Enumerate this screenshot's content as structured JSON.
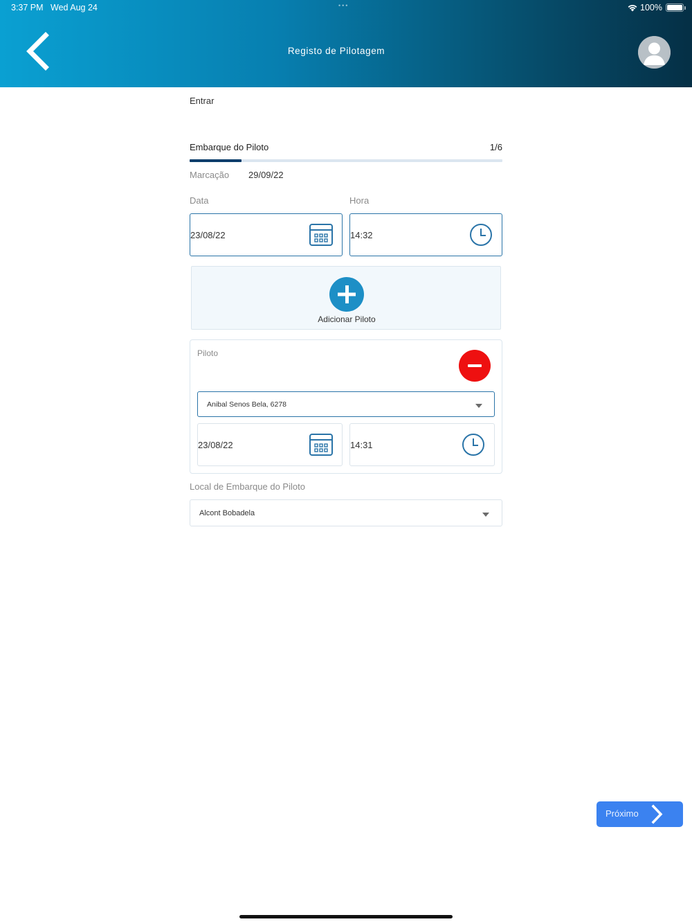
{
  "status_bar": {
    "time": "3:37 PM",
    "date": "Wed Aug 24",
    "dots": "•••",
    "battery": "100%"
  },
  "header": {
    "title": "Registo de Pilotagem",
    "back_icon": "chevron-left-icon",
    "avatar_icon": "user-avatar-icon"
  },
  "section": {
    "label": "Entrar"
  },
  "step": {
    "title": "Embarque do Piloto",
    "counter": "1/6",
    "progress": 0.1667
  },
  "marcacao": {
    "label": "Marcação",
    "value": "29/09/22"
  },
  "date_time": {
    "data_label": "Data",
    "data_value": "23/08/22",
    "hora_label": "Hora",
    "hora_value": "14:32"
  },
  "add_pilot": {
    "label": "Adicionar Piloto",
    "icon": "plus-circle-icon"
  },
  "pilot_card": {
    "label": "Piloto",
    "remove_icon": "minus-circle-icon",
    "selected_pilot": "Anibal Senos Bela, 6278",
    "date_value": "23/08/22",
    "time_value": "14:31"
  },
  "local": {
    "label": "Local de Embarque do Piloto",
    "selected": "Alcont Bobadela"
  },
  "footer": {
    "next_label": "Próximo",
    "next_icon": "chevron-right-icon"
  },
  "colors": {
    "header_gradient_start": "#0aa0d2",
    "header_gradient_end": "#052f45",
    "accent_blue": "#2a74a8",
    "progress_fill": "#0a3d6b",
    "add_button": "#1d8fc6",
    "remove_button": "#ee1010",
    "next_button": "#3b82f0"
  }
}
